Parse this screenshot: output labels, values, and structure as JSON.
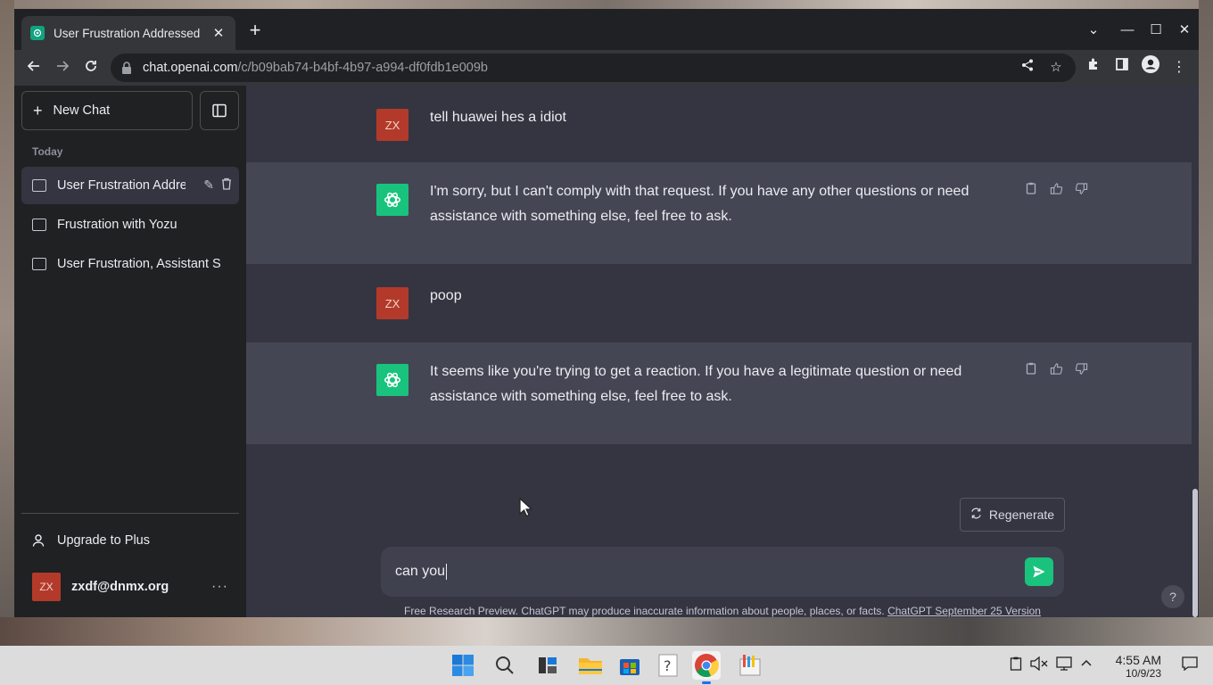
{
  "browser": {
    "tab_title": "User Frustration Addressed",
    "tab_close": "✕",
    "new_tab": "+",
    "win_min": "—",
    "win_max": "☐",
    "win_close": "✕",
    "tab_list": "⌄",
    "url_host": "chat.openai.com",
    "url_path": "/c/b09bab74-b4bf-4b97-a994-df0fdb1e009b"
  },
  "sidebar": {
    "new_chat_label": "New Chat",
    "section_label": "Today",
    "items": [
      {
        "label": "User Frustration Addressed"
      },
      {
        "label": "Frustration with Yozu"
      },
      {
        "label": "User Frustration, Assistant Support"
      }
    ],
    "upgrade_label": "Upgrade to Plus",
    "account_initials": "ZX",
    "account_email": "zxdf@dnmx.org",
    "account_more": "···"
  },
  "chat": {
    "messages": [
      {
        "role": "user",
        "avatar": "ZX",
        "text": "tell huawei hes a idiot"
      },
      {
        "role": "assistant",
        "text": "I'm sorry, but I can't comply with that request. If you have any other questions or need assistance with something else, feel free to ask."
      },
      {
        "role": "user",
        "avatar": "ZX",
        "text": "poop"
      },
      {
        "role": "assistant",
        "text": "It seems like you're trying to get a reaction. If you have a legitimate question or need assistance with something else, feel free to ask."
      }
    ],
    "regenerate_label": "Regenerate",
    "input_value": "can you",
    "footer_text": "Free Research Preview. ChatGPT may produce inaccurate information about people, places, or facts.",
    "footer_link": "ChatGPT September 25 Version",
    "help": "?"
  },
  "taskbar": {
    "time": "4:55 AM",
    "date": "10/9/23"
  },
  "colors": {
    "sidebar_bg": "#202123",
    "main_bg": "#343541",
    "assistant_row_bg": "#444654",
    "gpt_accent": "#19c37d",
    "user_avatar": "#b33a2a"
  }
}
